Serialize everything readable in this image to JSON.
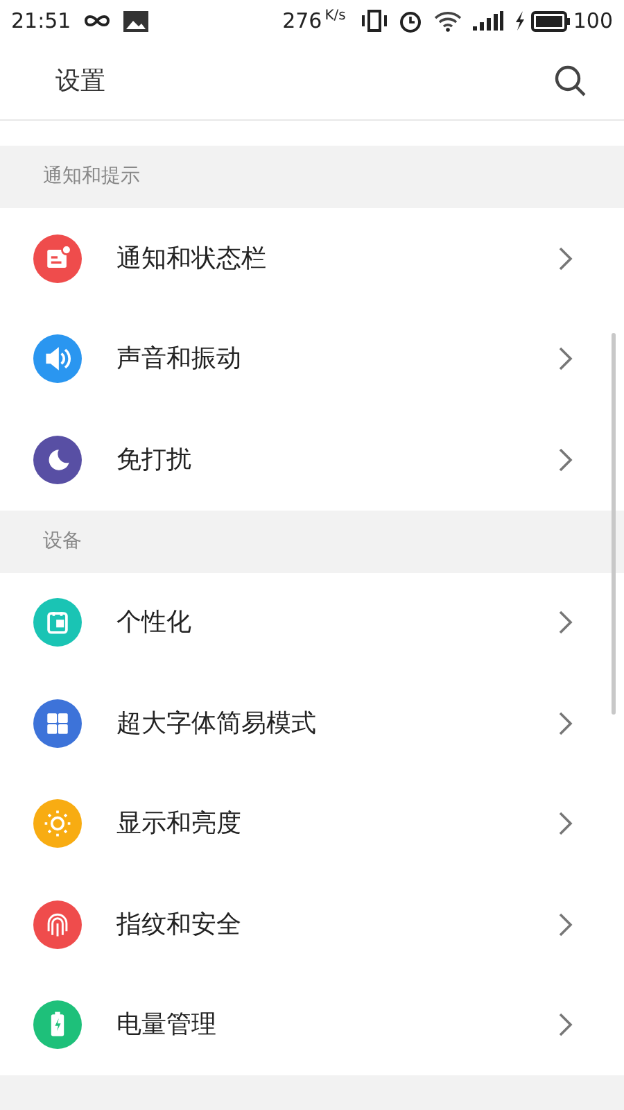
{
  "status_bar": {
    "time": "21:51",
    "speed": "276",
    "speed_unit": "K/s",
    "battery": "100"
  },
  "header": {
    "title": "设置"
  },
  "sections": [
    {
      "title": "通知和提示",
      "items": [
        {
          "label": "通知和状态栏",
          "kind": "notification",
          "color": "#ef4c4c"
        },
        {
          "label": "声音和振动",
          "kind": "sound",
          "color": "#2a96f0"
        },
        {
          "label": "免打扰",
          "kind": "moon",
          "color": "#584fa4"
        }
      ]
    },
    {
      "title": "设备",
      "items": [
        {
          "label": "个性化",
          "kind": "theme",
          "color": "#1ac4b4"
        },
        {
          "label": "超大字体简易模式",
          "kind": "grid",
          "color": "#3d73d9"
        },
        {
          "label": "显示和亮度",
          "kind": "sun",
          "color": "#f8ac12"
        },
        {
          "label": "指纹和安全",
          "kind": "fingerprint",
          "color": "#ef4c4c"
        },
        {
          "label": "电量管理",
          "kind": "battery",
          "color": "#1ec07a"
        }
      ]
    }
  ]
}
